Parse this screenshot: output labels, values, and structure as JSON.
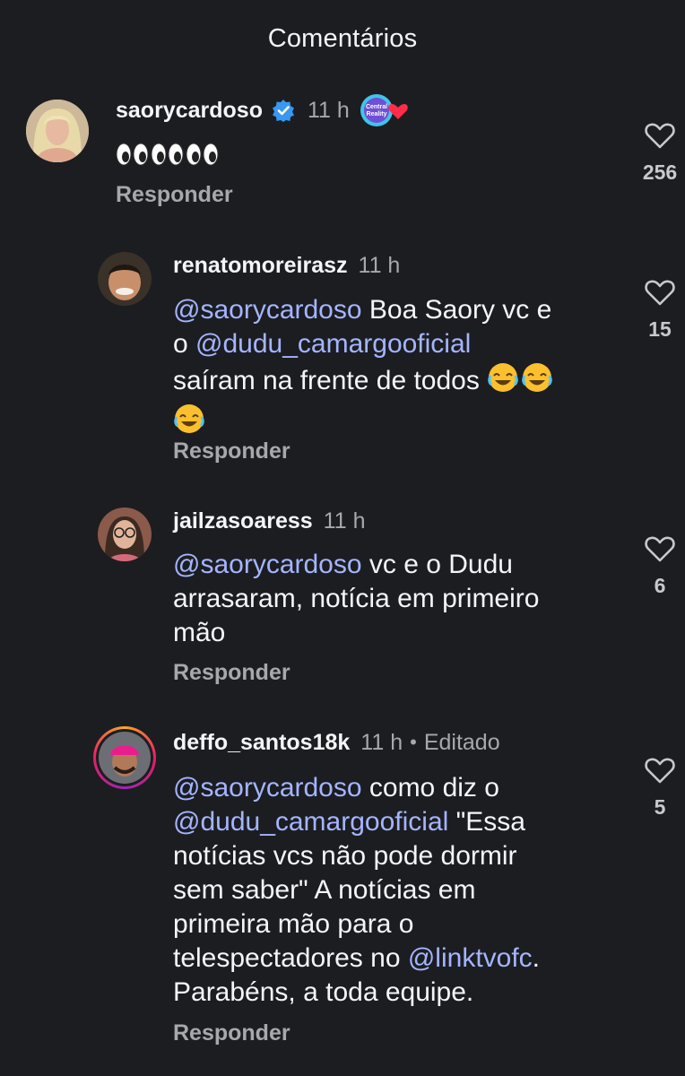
{
  "header": {
    "title": "Comentários"
  },
  "comments": [
    {
      "username": "saorycardoso",
      "time": "11 h",
      "verified": true,
      "badge_text": "Central Reality",
      "text_emoji": "👀👀👀",
      "reply_label": "Responder",
      "likes": "256"
    },
    {
      "username": "renatomoreirasz",
      "time": "11 h",
      "mention1": "@saorycardoso",
      "text_a": " Boa Saory vc e",
      "text_b": "o ",
      "mention2": "@dudu_camargooficial",
      "text_c": "saíram na frente de todos ",
      "emoji": "😂",
      "reply_label": "Responder",
      "likes": "15"
    },
    {
      "username": "jailzasoaress",
      "time": "11 h",
      "mention1": "@saorycardoso",
      "text_a": " vc e o Dudu",
      "text_b": "arrasaram, notícia em primeiro",
      "text_c": "mão",
      "reply_label": "Responder",
      "likes": "6"
    },
    {
      "username": "deffo_santos18k",
      "time": "11 h",
      "separator": "•",
      "edited": "Editado",
      "mention1": "@saorycardoso",
      "text_a": " como diz o",
      "mention2": "@dudu_camargooficial",
      "text_b": " \"Essa",
      "text_c": "notícias vcs não pode dormir",
      "text_d": "sem saber\"  A notícias em",
      "text_e": "primeira mão para o",
      "text_f": "telespectadores no ",
      "mention3": "@linktvofc",
      "text_g": ".",
      "text_h": "Parabéns, a toda equipe.",
      "reply_label": "Responder",
      "likes": "5"
    }
  ],
  "colors": {
    "background": "#1c1d21",
    "mention": "#a4b5ff",
    "muted": "#a8a8ac",
    "verified": "#3897f0"
  },
  "icons": [
    "verified-icon",
    "heart-icon",
    "central-reality-badge",
    "red-heart-icon",
    "eyes-emoji",
    "laughing-emoji"
  ]
}
